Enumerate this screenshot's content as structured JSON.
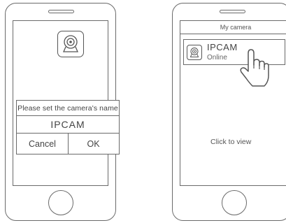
{
  "left_phone": {
    "dialog": {
      "title": "Please set the camera's name",
      "input_value": "IPCAM",
      "cancel_label": "Cancel",
      "ok_label": "OK"
    }
  },
  "right_phone": {
    "header_title": "My camera",
    "camera": {
      "name": "IPCAM",
      "status": "Online"
    },
    "hint": "Click to view"
  },
  "icons": {
    "camera": "camera-icon",
    "hand": "pointing-hand-icon"
  }
}
